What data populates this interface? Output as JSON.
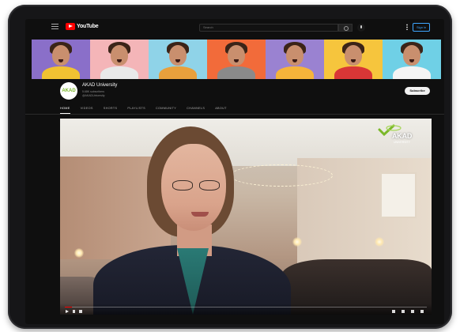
{
  "masthead": {
    "logo_text": "YouTube",
    "search_placeholder": "Search",
    "signin_label": "Sign in"
  },
  "banner": {
    "tiles": [
      {
        "bg": "#8a6fc9",
        "shirt": "#f1c232"
      },
      {
        "bg": "#f4b5b8",
        "shirt": "#e9e9e9"
      },
      {
        "bg": "#8fd3e8",
        "shirt": "#e8a03c"
      },
      {
        "bg": "#f26b3a",
        "shirt": "#8a8a8a"
      },
      {
        "bg": "#9a82d1",
        "shirt": "#f5b43a"
      },
      {
        "bg": "#f6c53d",
        "shirt": "#d93636"
      },
      {
        "bg": "#6fd0e6",
        "shirt": "#f4f4f4"
      }
    ]
  },
  "channel": {
    "avatar_text": "AKAD",
    "name": "AKAD University",
    "subscribers": "5.68K subscribers",
    "handle": "@AKADUniversity",
    "subscribe_label": "Subscribe"
  },
  "tabs": [
    "HOME",
    "VIDEOS",
    "SHORTS",
    "PLAYLISTS",
    "COMMUNITY",
    "CHANNELS",
    "ABOUT"
  ],
  "active_tab": "HOME",
  "video": {
    "brand_name": "AKAD",
    "brand_sub": "UNIVERSITY",
    "progress_fraction": 0.02
  },
  "colors": {
    "accent_red": "#ff0000",
    "brand_green": "#7bb82a",
    "background": "#0f0f0f"
  }
}
